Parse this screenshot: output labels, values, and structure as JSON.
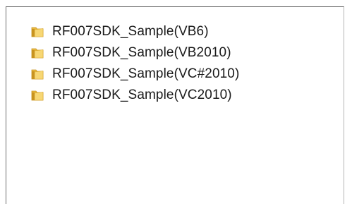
{
  "items": [
    {
      "label": "RF007SDK_Sample(VB6)",
      "icon": "folder-icon"
    },
    {
      "label": "RF007SDK_Sample(VB2010)",
      "icon": "folder-icon"
    },
    {
      "label": "RF007SDK_Sample(VC#2010)",
      "icon": "folder-icon"
    },
    {
      "label": "RF007SDK_Sample(VC2010)",
      "icon": "folder-icon"
    }
  ],
  "colors": {
    "folder_light": "#f7d774",
    "folder_dark": "#d9a72a",
    "text": "#1a1a1a",
    "border": "#6e6e6e"
  }
}
